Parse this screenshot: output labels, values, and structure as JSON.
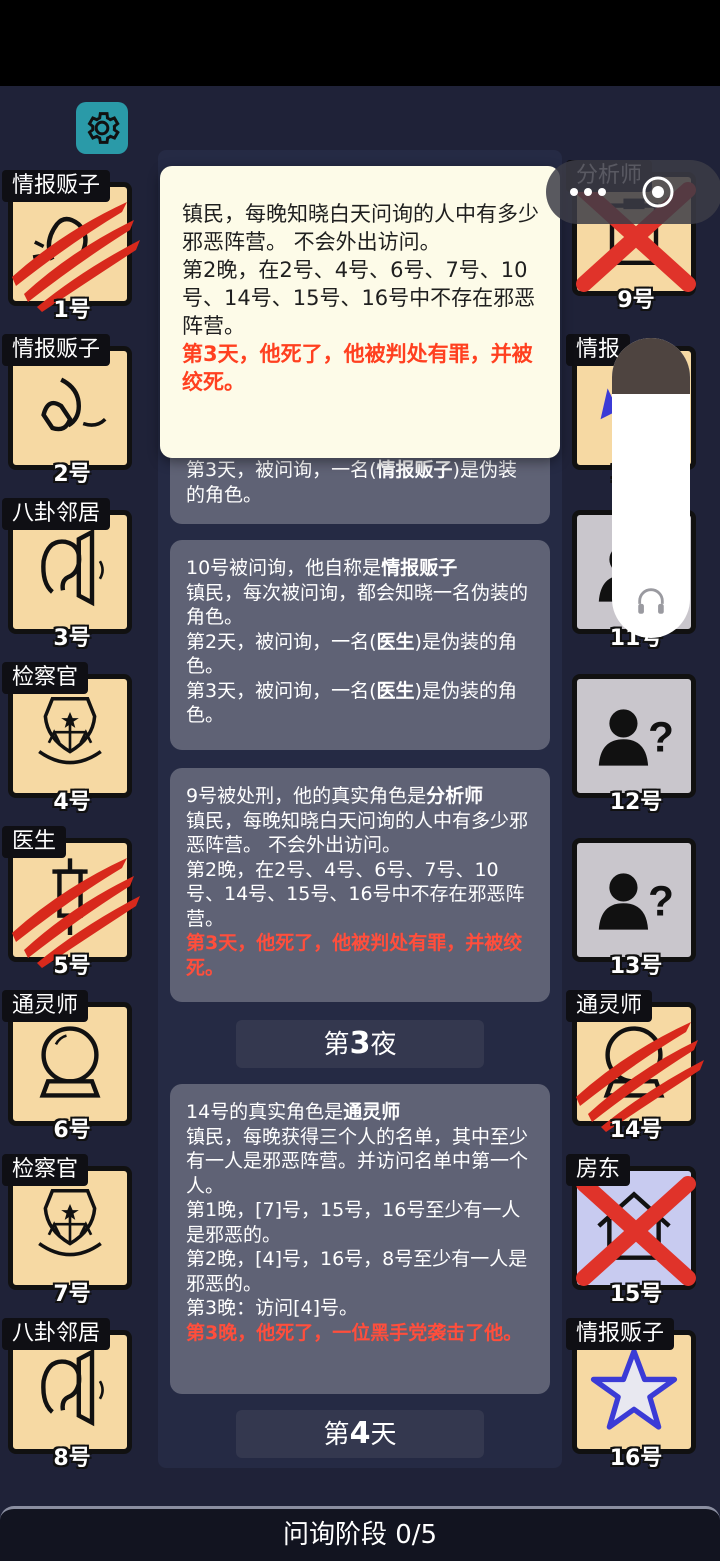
{
  "players_left": [
    {
      "role": "情报贩子",
      "num": "1号"
    },
    {
      "role": "情报贩子",
      "num": "2号"
    },
    {
      "role": "八卦邻居",
      "num": "3号"
    },
    {
      "role": "检察官",
      "num": "4号"
    },
    {
      "role": "医生",
      "num": "5号"
    },
    {
      "role": "通灵师",
      "num": "6号"
    },
    {
      "role": "检察官",
      "num": "7号"
    },
    {
      "role": "八卦邻居",
      "num": "8号"
    }
  ],
  "players_right": [
    {
      "role": "分析师",
      "num": "9号"
    },
    {
      "role": "情报",
      "num": "10号"
    },
    {
      "role": "",
      "num": "11号"
    },
    {
      "role": "",
      "num": "12号"
    },
    {
      "role": "",
      "num": "13号"
    },
    {
      "role": "通灵师",
      "num": "14号"
    },
    {
      "role": "房东",
      "num": "15号"
    },
    {
      "role": "情报贩子",
      "num": "16号"
    }
  ],
  "popup": {
    "line1": "镇民，每晚知晓白天问询的人中有多少邪恶阵营。 不会外出访问。",
    "line2": "第2晚，在2号、4号、6号、7号、10号、14号、15号、16号中不存在邪恶阵营。",
    "death": "第3天，他死了，他被判处有罪，并被绞死。"
  },
  "log": {
    "e1_l1": "第3天，被问询，一名(",
    "e1_role": "情报贩子",
    "e1_l2": ")是伪装的角色。",
    "e2_head": "10号被问询，他自称是",
    "e2_role": "情报贩子",
    "e2_desc": "镇民，每次被问询，都会知晓一名伪装的角色。",
    "e2_d2a": "第2天，被问询，一名(",
    "e2_d2role": "医生",
    "e2_d2b": ")是伪装的角色。",
    "e2_d3a": "第3天，被问询，一名(",
    "e2_d3role": "医生",
    "e2_d3b": ")是伪装的角色。",
    "e3_head": "9号被处刑，他的真实角色是",
    "e3_role": "分析师",
    "e3_desc": "镇民，每晚知晓白天问询的人中有多少邪恶阵营。 不会外出访问。",
    "e3_n2": "第2晚，在2号、4号、6号、7号、10号、14号、15号、16号中不存在邪恶阵营。",
    "e3_death": "第3天，他死了，他被判处有罪，并被绞死。",
    "e4_head": "14号的真实角色是",
    "e4_role": "通灵师",
    "e4_desc": "镇民，每晚获得三个人的名单，其中至少有一人是邪恶阵营。并访问名单中第一个人。",
    "e4_n1": "第1晚，[7]号，15号，16号至少有一人是邪恶的。",
    "e4_n2": "第2晚，[4]号，16号，8号至少有一人是邪恶的。",
    "e4_n3": "第3晚：访问[4]号。",
    "e4_death": "第3晚，他死了，一位黑手党袭击了他。"
  },
  "phases": {
    "night_pre": "第",
    "night_num": "3",
    "night_post": "夜",
    "day_pre": "第",
    "day_num": "4",
    "day_post": "天"
  },
  "bottom": {
    "label": "问询阶段 0/5"
  },
  "colors": {
    "card_bg": "#f6d9a3",
    "death_red": "#ff4e3c",
    "claw_red": "#d8291c",
    "x_red": "#e0332a"
  }
}
